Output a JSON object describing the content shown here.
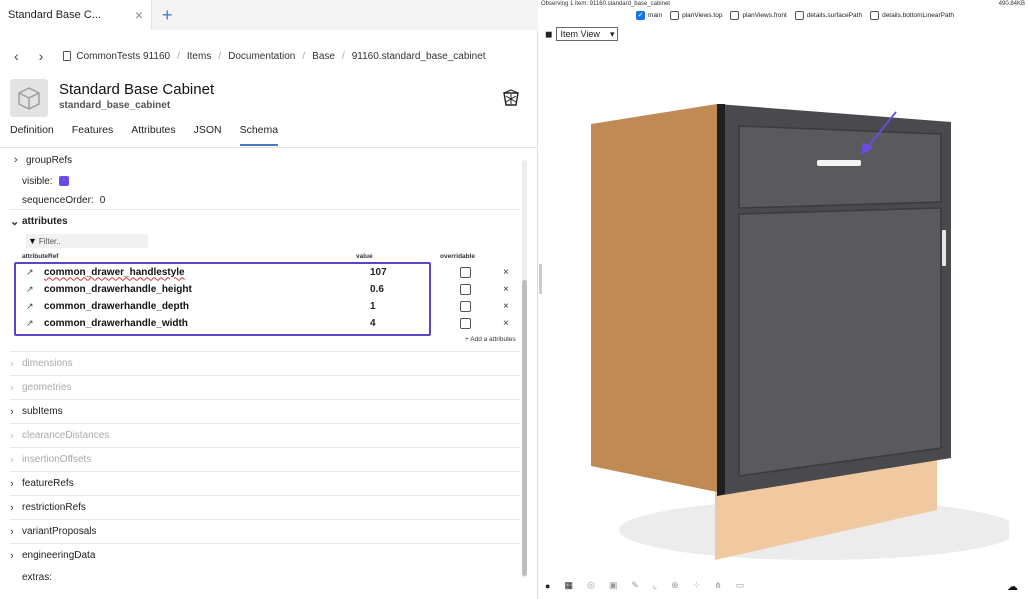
{
  "tabbar": {
    "tab_label": "Standard Base C...",
    "close": "×",
    "new": "+"
  },
  "breadcrumb": {
    "back": "‹",
    "forward": "›",
    "items": [
      "CommonTests 91160",
      "Items",
      "Documentation",
      "Base",
      "91160.standard_base_cabinet"
    ],
    "sep": "/"
  },
  "header": {
    "title": "Standard Base Cabinet",
    "subtitle": "standard_base_cabinet"
  },
  "tabs": [
    "Definition",
    "Features",
    "Attributes",
    "JSON",
    "Schema"
  ],
  "active_tab": "Schema",
  "schema": {
    "groupRefs": "groupRefs",
    "visible_label": "visible:",
    "sequence_label": "sequenceOrder:",
    "sequence_value": "0",
    "attributes_label": "attributes",
    "filter_placeholder": "Filter..",
    "col_attributeRef": "attributeRef",
    "col_value": "value",
    "col_overridable": "overridable",
    "attribute_rows": [
      {
        "name": "common_drawer_handlestyle",
        "value": "107",
        "remove": "×"
      },
      {
        "name": "common_drawerhandle_height",
        "value": "0.6",
        "remove": "×"
      },
      {
        "name": "common_drawerhandle_depth",
        "value": "1",
        "remove": "×"
      },
      {
        "name": "common_drawerhandle_width",
        "value": "4",
        "remove": "×"
      }
    ],
    "add_attributes": "+ Add a attributes",
    "sections": [
      {
        "label": "dimensions",
        "dim": true
      },
      {
        "label": "geometries",
        "dim": true
      },
      {
        "label": "subItems",
        "dim": false
      },
      {
        "label": "clearanceDistances",
        "dim": true
      },
      {
        "label": "insertionOffsets",
        "dim": true
      },
      {
        "label": "featureRefs",
        "dim": false
      },
      {
        "label": "restrictionRefs",
        "dim": false
      },
      {
        "label": "variantProposals",
        "dim": false
      },
      {
        "label": "engineeringData",
        "dim": false
      }
    ],
    "extras_label": "extras:"
  },
  "viewer": {
    "observing": "Observing 1 item: 91160.standard_base_cabinet",
    "size": "490.84KB",
    "layers": [
      {
        "label": "main",
        "checked": true
      },
      {
        "label": "planViews.top",
        "checked": false
      },
      {
        "label": "planViews.front",
        "checked": false
      },
      {
        "label": "details.surfacePath",
        "checked": false
      },
      {
        "label": "details.bottomLinearPath",
        "checked": false
      }
    ],
    "view_select": "Item View",
    "colors": {
      "cabinet_side": "#c08a55",
      "door": "#4a4a4e",
      "toe_kick": "#f1c9a0",
      "arrow": "#6b4de6"
    }
  }
}
